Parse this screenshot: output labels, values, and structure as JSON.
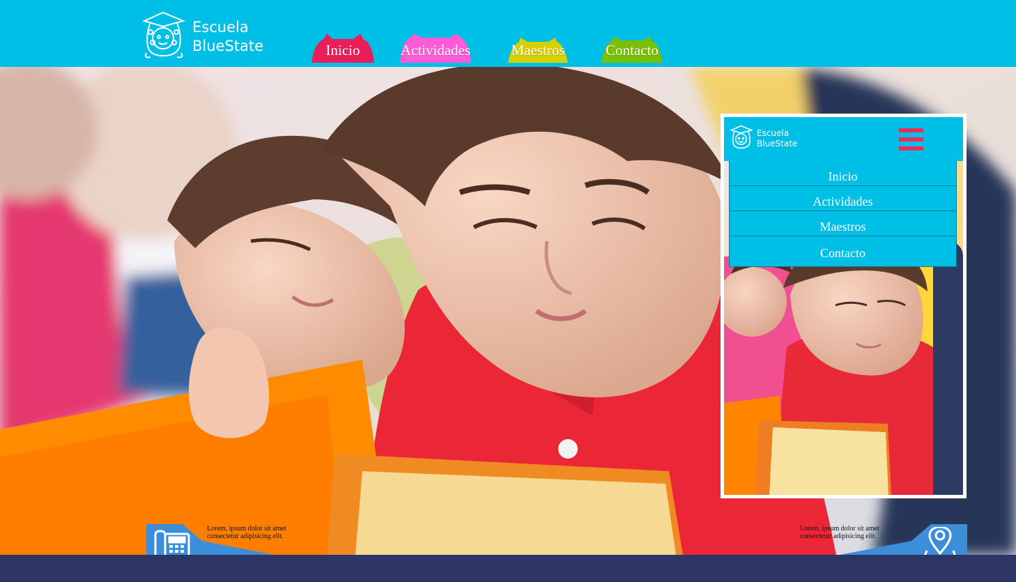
{
  "brand": {
    "line1": "Escuela",
    "line2": "BlueState"
  },
  "nav": [
    {
      "label": "Inicio",
      "color": "#e91e5b"
    },
    {
      "label": "Actividades",
      "color": "#ff5ad7"
    },
    {
      "label": "Maestros",
      "color": "#d7d000"
    },
    {
      "label": "Contacto",
      "color": "#79c000"
    }
  ],
  "mobile": {
    "brand_line1": "Escuela",
    "brand_line2": "BlueState",
    "menu": [
      "Inicio",
      "Actividades",
      "Maestros",
      "Contacto"
    ]
  },
  "footer": {
    "phone_text": "Lorem, ipsum dolor sit amet consectetur adipisicing elit.",
    "location_text": "Lorem, ipsum dolor sit amet consectetur adipisicing elit."
  },
  "icons": [
    "school-logo-icon",
    "menu-icon",
    "phone-icon",
    "location-pin-icon"
  ],
  "colors": {
    "header": "#00bfe6",
    "footer": "#2c3566",
    "accent_blue": "#3d8ed8",
    "burger": "#e62e5c"
  }
}
